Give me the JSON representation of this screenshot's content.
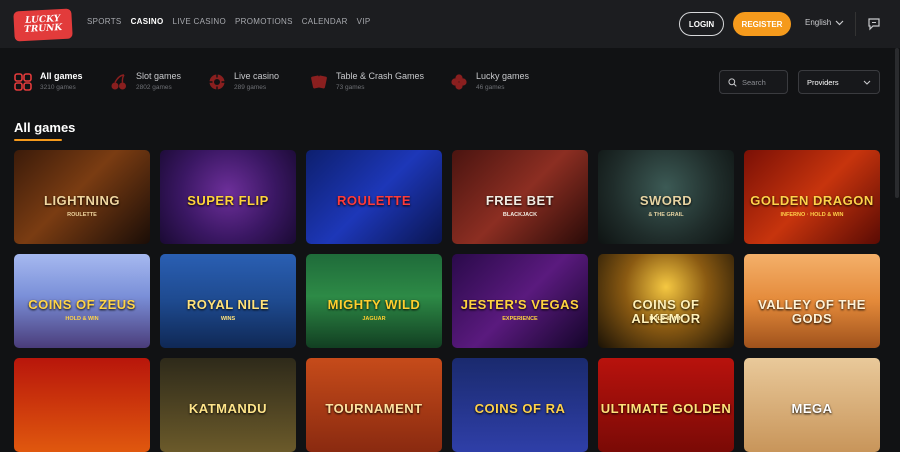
{
  "header": {
    "logo_top": "LUCKY",
    "logo_bottom": "TRUNK",
    "nav": [
      "SPORTS",
      "CASINO",
      "LIVE CASINO",
      "PROMOTIONS",
      "CALENDAR",
      "VIP"
    ],
    "active_nav": "CASINO",
    "login_label": "LOGIN",
    "register_label": "REGISTER",
    "language": "English",
    "accent_color": "#f59a1c",
    "brand_color": "#e23b3b"
  },
  "categories": [
    {
      "label": "All games",
      "count": "3210 games",
      "icon": "grid-icon"
    },
    {
      "label": "Slot games",
      "count": "2802 games",
      "icon": "cherries-icon"
    },
    {
      "label": "Live casino",
      "count": "289 games",
      "icon": "roulette-chip-icon"
    },
    {
      "label": "Table & Crash Games",
      "count": "73 games",
      "icon": "cards-icon"
    },
    {
      "label": "Lucky games",
      "count": "46 games",
      "icon": "clover-icon"
    }
  ],
  "filters": {
    "search_placeholder": "Search",
    "providers_label": "Providers"
  },
  "section_title": "All games",
  "games": [
    {
      "name": "LIGHTNING",
      "sub": "ROULETTE",
      "bg": "linear-gradient(135deg,#3b1b0a 0%,#7a3c12 45%,#1a0d07 100%)",
      "color": "#f0d6a0"
    },
    {
      "name": "SUPER FLIP",
      "sub": "",
      "bg": "radial-gradient(circle at 50% 45%,#6d2f9a 0%,#3a1763 55%,#1a0a33 100%)",
      "color": "#ffd43a"
    },
    {
      "name": "ROULETTE",
      "sub": "",
      "bg": "linear-gradient(135deg,#0d1f6e 0%,#1d37b8 50%,#0a1550 100%)",
      "color": "#ff3a3a"
    },
    {
      "name": "FREE BET",
      "sub": "BLACKJACK",
      "bg": "linear-gradient(135deg,#4a1410 0%,#8c2e22 50%,#2a0b08 100%)",
      "color": "#f2ece2"
    },
    {
      "name": "SWORD",
      "sub": "& THE GRAIL",
      "bg": "radial-gradient(circle at 50% 40%,#3c5a55 0%,#1f2c2a 60%,#0e1312 100%)",
      "color": "#e7d4a3"
    },
    {
      "name": "GOLDEN DRAGON",
      "sub": "INFERNO · HOLD & WIN",
      "bg": "linear-gradient(135deg,#7a1006 0%,#c7340d 50%,#5a0b04 100%)",
      "color": "#ffd24a"
    },
    {
      "name": "COINS OF ZEUS",
      "sub": "HOLD & WIN",
      "bg": "linear-gradient(180deg,#a6b9f0 0%,#7a8fd8 45%,#4a3c7a 100%)",
      "color": "#ffd447"
    },
    {
      "name": "ROYAL NILE",
      "sub": "WINS",
      "bg": "linear-gradient(180deg,#2a5fb3 0%,#1e4a8f 50%,#0f2855 100%)",
      "color": "#ffe27a"
    },
    {
      "name": "MIGHTY WILD",
      "sub": "JAGUAR",
      "bg": "linear-gradient(180deg,#1f6b3a 0%,#2d8a46 45%,#123f22 100%)",
      "color": "#ffcf2e"
    },
    {
      "name": "JESTER'S VEGAS",
      "sub": "EXPERIENCE",
      "bg": "linear-gradient(135deg,#2a0a4a 0%,#5a1a7e 50%,#14052a 100%)",
      "color": "#ffd23f"
    },
    {
      "name": "COINS OF ALKEMOR",
      "sub": "HOLD & WIN",
      "bg": "radial-gradient(circle at 50% 35%,#f5c842 0%,#8a5a12 45%,#1a1206 100%)",
      "color": "#fff1b8"
    },
    {
      "name": "VALLEY OF THE GODS",
      "sub": "",
      "bg": "linear-gradient(180deg,#f4b06a 0%,#e48a3a 50%,#a0521c 100%)",
      "color": "#fff3d8"
    },
    {
      "name": "",
      "sub": "",
      "bg": "linear-gradient(180deg,#b8160b 0%,#e0580e 100%)",
      "color": "#ffd24a"
    },
    {
      "name": "KATMANDU",
      "sub": "",
      "bg": "linear-gradient(180deg,#2e2a1a 0%,#6b5a2a 100%)",
      "color": "#ffe58a"
    },
    {
      "name": "TOURNAMENT",
      "sub": "",
      "bg": "linear-gradient(180deg,#c64b1a 0%,#8a2a10 100%)",
      "color": "#ffe2a0"
    },
    {
      "name": "COINS OF RA",
      "sub": "",
      "bg": "linear-gradient(180deg,#1a2a6e 0%,#2f3fa8 100%)",
      "color": "#ffd24a"
    },
    {
      "name": "ULTIMATE GOLDEN",
      "sub": "",
      "bg": "linear-gradient(180deg,#b8120d 0%,#7a0a06 100%)",
      "color": "#ffe27a"
    },
    {
      "name": "MEGA",
      "sub": "",
      "bg": "linear-gradient(180deg,#e9c99a 0%,#c8955a 100%)",
      "color": "#fff"
    }
  ]
}
